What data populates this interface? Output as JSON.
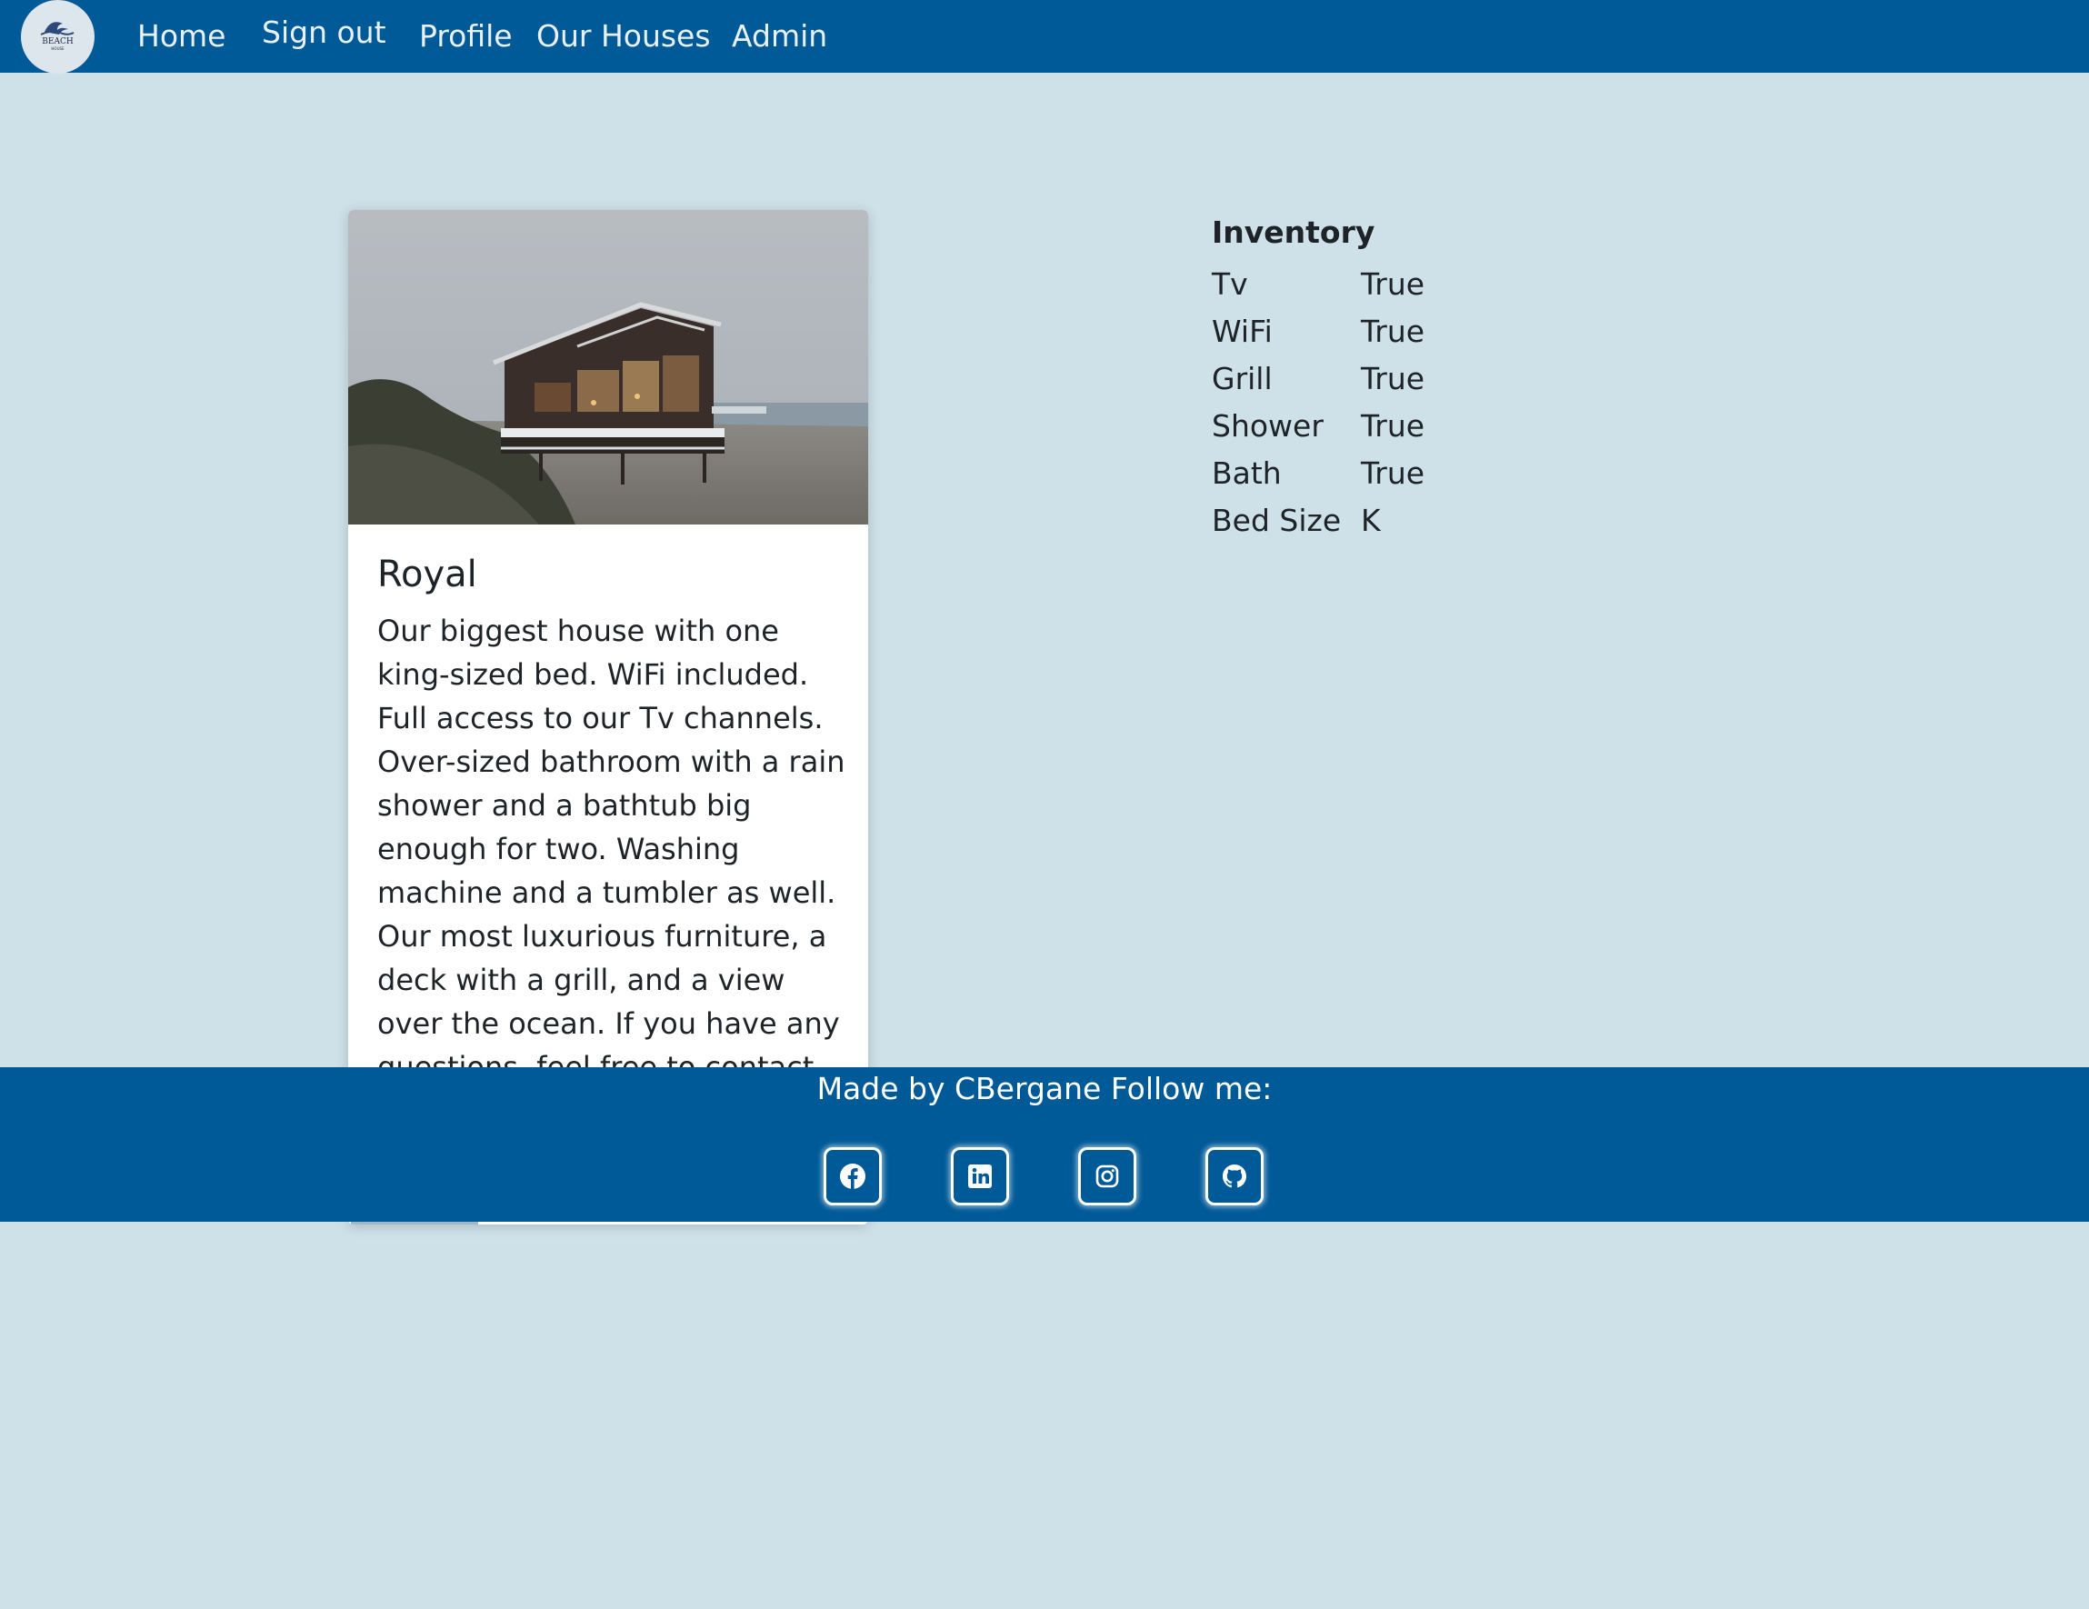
{
  "nav": {
    "logo": {
      "line1": "BEACH",
      "line2": "HOUSE"
    },
    "links": [
      "Home",
      "Sign out",
      "Profile",
      "Our Houses",
      "Admin"
    ]
  },
  "house": {
    "title": "Royal",
    "description": "Our biggest house with one king-sized bed. WiFi included. Full access to our Tv channels. Over-sized bathroom with a rain shower and a bathtub big enough for two. Washing machine and a tumbler as well. Our most luxurious furniture, a deck with a grill, and a view over the ocean. If you have any questions, feel free to contact"
  },
  "inventory": {
    "title": "Inventory",
    "rows": [
      {
        "key": "Tv",
        "value": "True"
      },
      {
        "key": "WiFi",
        "value": "True"
      },
      {
        "key": "Grill",
        "value": "True"
      },
      {
        "key": "Shower",
        "value": "True"
      },
      {
        "key": "Bath",
        "value": "True"
      },
      {
        "key": "Bed Size",
        "value": "K"
      }
    ]
  },
  "footer": {
    "text": "Made by CBergane Follow me:",
    "social": [
      "facebook-icon",
      "linkedin-icon",
      "instagram-icon",
      "github-icon"
    ]
  },
  "colors": {
    "navbar": "#005a98",
    "background": "#cee1e9",
    "card": "#ffffff",
    "text": "#1e2328"
  }
}
